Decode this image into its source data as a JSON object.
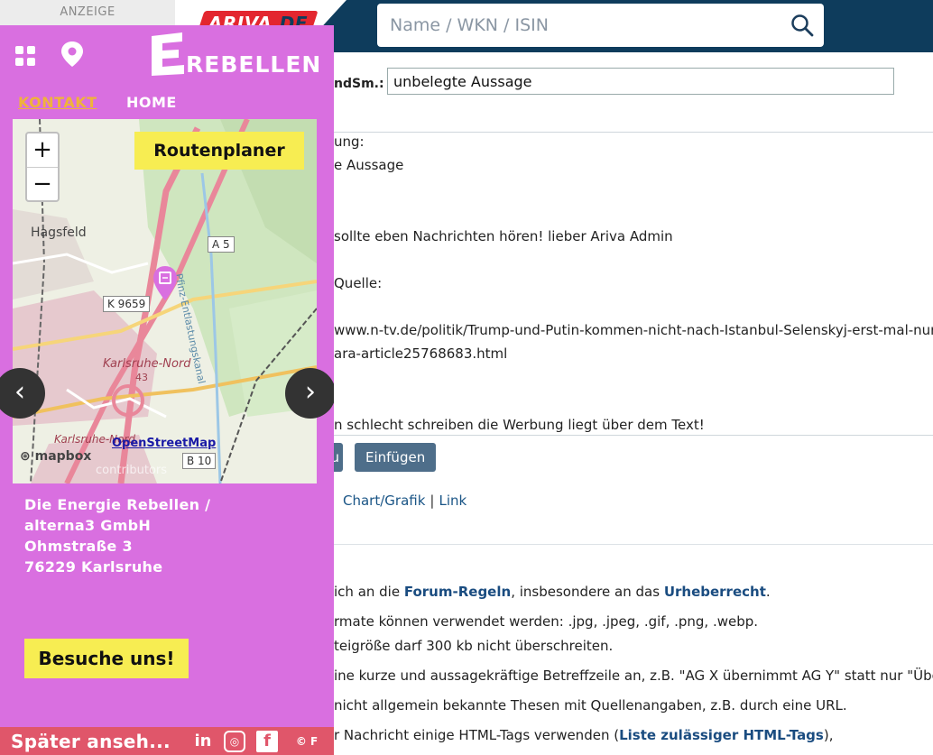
{
  "ad": {
    "label": "ANZEIGE",
    "brand": "REBELLEN",
    "nav": {
      "kontakt": "KONTAKT",
      "home": "HOME"
    },
    "map": {
      "route_planner": "Routenplaner",
      "zoom_in": "+",
      "zoom_out": "−",
      "places": [
        "Hagsfeld",
        "Karlsruhe-Nord",
        "Karlsruhe-Nord"
      ],
      "roads": [
        "A 5",
        "K 9659",
        "B 10",
        "43"
      ],
      "canal": "Pfinz-Entlastungskanal",
      "attribution_mapbox": "mapbox",
      "attribution_osm": "OpenStreetMap",
      "attribution_contrib": "contributors"
    },
    "carousel": {
      "prev": "‹",
      "next": "›"
    },
    "address": {
      "line1": "Die Energie Rebellen /",
      "line2": "alterna3 GmbH",
      "line3": "Ohmstraße 3",
      "line4": "76229 Karlsruhe"
    },
    "cta": "Besuche uns!",
    "bottom_bar": {
      "watch_later": "Später anseh...",
      "linkedin": "in",
      "instagram": "◎",
      "facebook": "f",
      "copyright": "© F"
    }
  },
  "header": {
    "logo": "ARIVA",
    "logo_tld": ".DE",
    "search_placeholder": "Name / WKN / ISIN"
  },
  "form": {
    "subject_label": "ndSm.:",
    "subject_value": "unbelegte Aussage",
    "quote_lines": [
      "ung:",
      "e Aussage",
      "sollte eben Nachrichten hören! lieber Ariva Admin",
      "Quelle:",
      "www.n-tv.de/politik/Trump-und-Putin-kommen-nicht-nach-Istanbul-Selenskyj-erst-mal-nur-",
      "ara-article25768683.html",
      "n schlecht schreiben die Werbung liegt über dem Text!"
    ],
    "btn_left": "u",
    "btn_insert": "Einfügen",
    "links": [
      "Chart/Grafik",
      "Link"
    ],
    "link_sep": "|"
  },
  "rules": {
    "r1_pre": "ich an die ",
    "r1_link1": "Forum-Regeln",
    "r1_mid": ", insbesondere an das ",
    "r1_link2": "Urheberrecht",
    "r1_post": ".",
    "r2": "rmate können verwendet werden: .jpg, .jpeg, .gif, .png, .webp.",
    "r3": "teigröße darf 300 kb nicht überschreiten.",
    "r4": "ine kurze und aussagekräftige Betreffzeile an, z.B. \"AG X übernimmt AG Y\" statt nur \"Übernah",
    "r5": " nicht allgemein bekannte Thesen mit Quellenangaben, z.B. durch eine URL.",
    "r6_pre": "r Nachricht einige HTML-Tags verwenden (",
    "r6_link": "Liste zulässiger HTML-Tags",
    "r6_post": "),"
  }
}
